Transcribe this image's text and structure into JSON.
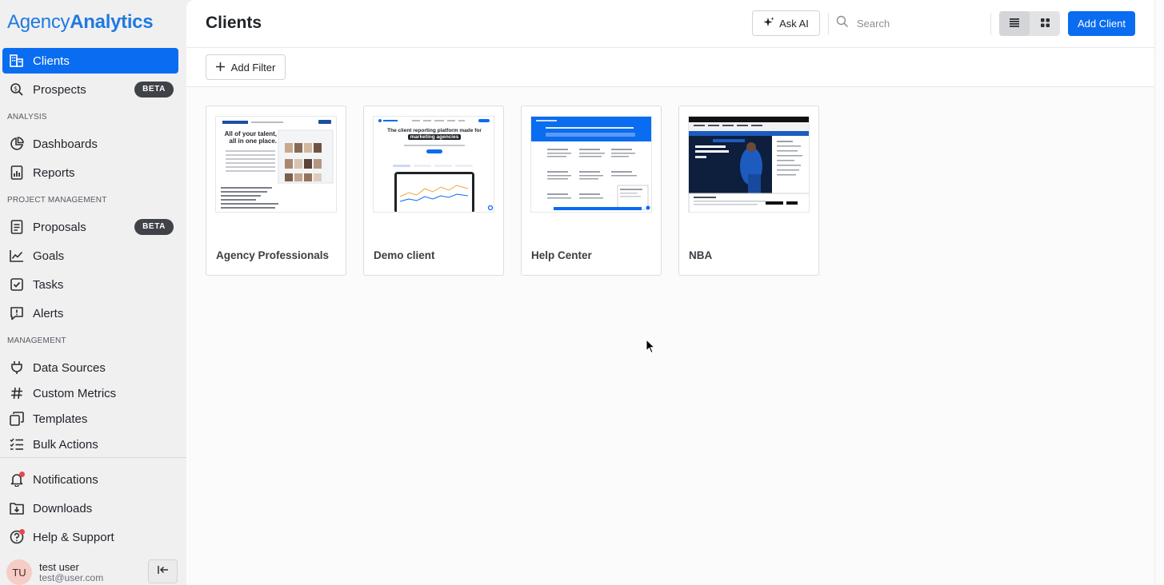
{
  "brand": {
    "part1": "Agency",
    "part2": "Analytics"
  },
  "sidebar": {
    "items": [
      {
        "label": "Clients",
        "icon": "building-icon",
        "active": true
      },
      {
        "label": "Prospects",
        "icon": "search-money-icon",
        "badge": "BETA"
      }
    ],
    "sections": {
      "analysis": "ANALYSIS",
      "project_management": "PROJECT MANAGEMENT",
      "management": "MANAGEMENT"
    },
    "analysis_items": [
      {
        "label": "Dashboards",
        "icon": "pie-chart-icon"
      },
      {
        "label": "Reports",
        "icon": "report-icon"
      }
    ],
    "project_items": [
      {
        "label": "Proposals",
        "icon": "document-icon",
        "badge": "BETA"
      },
      {
        "label": "Goals",
        "icon": "trend-line-icon"
      },
      {
        "label": "Tasks",
        "icon": "checkbox-icon"
      },
      {
        "label": "Alerts",
        "icon": "alert-icon"
      }
    ],
    "management_items": [
      {
        "label": "Data Sources",
        "icon": "plug-icon"
      },
      {
        "label": "Custom Metrics",
        "icon": "hashtag-icon"
      },
      {
        "label": "Templates",
        "icon": "templates-icon"
      },
      {
        "label": "Bulk Actions",
        "icon": "checklist-icon"
      }
    ],
    "bottom_items": [
      {
        "label": "Notifications",
        "icon": "bell-icon"
      },
      {
        "label": "Downloads",
        "icon": "download-icon"
      },
      {
        "label": "Help & Support",
        "icon": "help-icon"
      }
    ],
    "user": {
      "initials": "TU",
      "name": "test user",
      "email": "test@user.com"
    }
  },
  "header": {
    "title": "Clients",
    "ask_ai": "Ask AI",
    "search_placeholder": "Search",
    "add_client": "Add Client",
    "view": "grid"
  },
  "filters": {
    "add_filter": "Add Filter"
  },
  "clients": [
    {
      "name": "Agency Professionals",
      "thumb_headline": "All of your talent, all in one place."
    },
    {
      "name": "Demo client",
      "thumb_headline": "The client reporting platform made for",
      "thumb_highlight": "marketing agencies"
    },
    {
      "name": "Help Center"
    },
    {
      "name": "NBA"
    }
  ],
  "colors": {
    "accent": "#0a6cf0",
    "badge": "#3f4247",
    "notif_dot": "#e5484d",
    "nba_blue": "#1d5bbf"
  }
}
